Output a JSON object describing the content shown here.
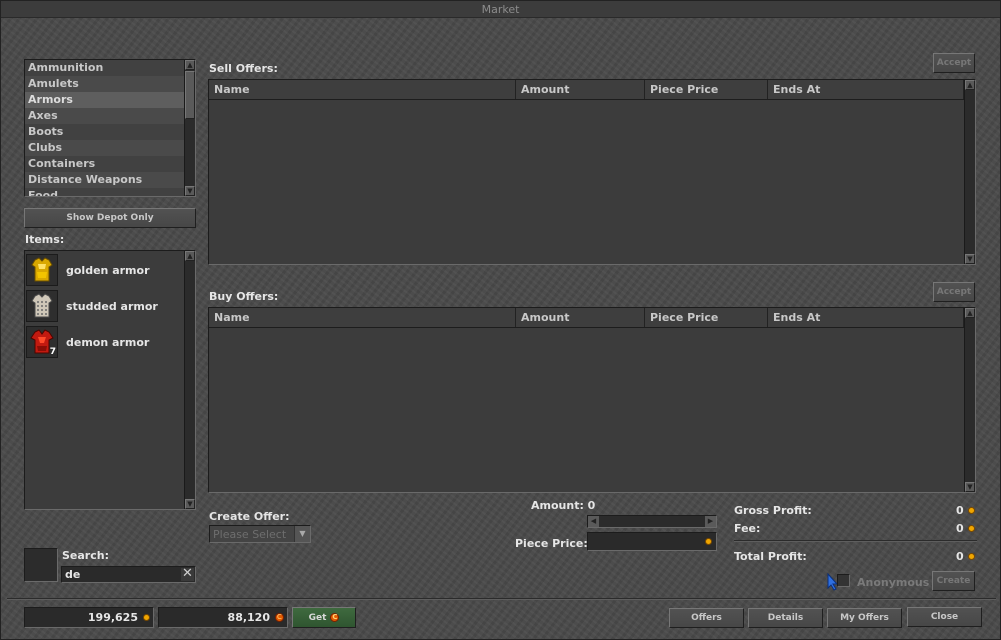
{
  "window": {
    "title": "Market"
  },
  "categories": {
    "items": [
      "Ammunition",
      "Amulets",
      "Armors",
      "Axes",
      "Boots",
      "Clubs",
      "Containers",
      "Distance Weapons",
      "Food"
    ],
    "selected_index": 2
  },
  "show_depot_only_label": "Show Depot Only",
  "items_section": {
    "label": "Items:",
    "items": [
      {
        "name": "golden armor",
        "icon": "golden-armor-icon",
        "count": ""
      },
      {
        "name": "studded armor",
        "icon": "studded-armor-icon",
        "count": ""
      },
      {
        "name": "demon armor",
        "icon": "demon-armor-icon",
        "count": "7"
      }
    ]
  },
  "search": {
    "label": "Search:",
    "value": "de"
  },
  "sell_offers": {
    "label": "Sell Offers:",
    "accept_label": "Accept",
    "columns": [
      "Name",
      "Amount",
      "Piece Price",
      "Ends At"
    ]
  },
  "buy_offers": {
    "label": "Buy Offers:",
    "accept_label": "Accept",
    "columns": [
      "Name",
      "Amount",
      "Piece Price",
      "Ends At"
    ]
  },
  "create_offer": {
    "label": "Create Offer:",
    "select_placeholder": "Please Select",
    "amount_label": "Amount: 0",
    "piece_price_label": "Piece Price:",
    "gross_profit_label": "Gross Profit:",
    "gross_profit_value": "0",
    "fee_label": "Fee:",
    "fee_value": "0",
    "total_profit_label": "Total Profit:",
    "total_profit_value": "0",
    "anonymous_label": "Anonymous",
    "create_label": "Create"
  },
  "balance": {
    "gold": "199,625",
    "tibia_coins": "88,120",
    "get_label": "Get"
  },
  "footer_buttons": {
    "offers": "Offers",
    "details": "Details",
    "my_offers": "My Offers",
    "close": "Close"
  },
  "colors": {
    "gold": "#f0a600",
    "tibia_coin": "#e25b00",
    "get_button": "#2f5530"
  }
}
